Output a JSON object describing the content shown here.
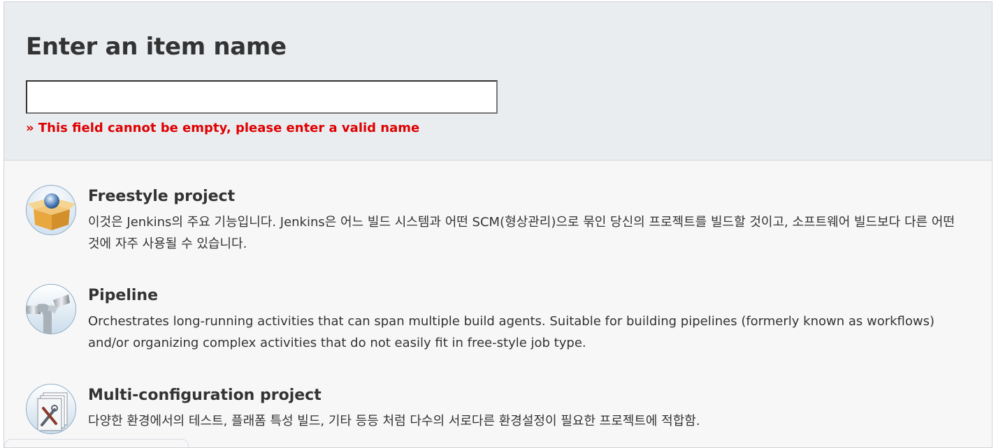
{
  "header": {
    "title": "Enter an item name",
    "name_input": {
      "value": "",
      "placeholder": ""
    },
    "error": "» This field cannot be empty, please enter a valid name"
  },
  "items": [
    {
      "icon": "freestyle-project-icon",
      "title": "Freestyle project",
      "description": "이것은 Jenkins의 주요 기능입니다. Jenkins은 어느 빌드 시스템과 어떤 SCM(형상관리)으로 묶인 당신의 프로젝트를 빌드할 것이고, 소프트웨어 빌드보다 다른 어떤 것에 자주 사용될 수 있습니다."
    },
    {
      "icon": "pipeline-icon",
      "title": "Pipeline",
      "description": "Orchestrates long-running activities that can span multiple build agents. Suitable for building pipelines (formerly known as workflows) and/or organizing complex activities that do not easily fit in free-style job type."
    },
    {
      "icon": "multi-configuration-icon",
      "title": "Multi-configuration project",
      "description": "다양한 환경에서의 테스트, 플래폼 특성 빌드, 기타 등등 처럼 다수의 서로다른 환경설정이 필요한 프로젝트에 적합함."
    }
  ]
}
